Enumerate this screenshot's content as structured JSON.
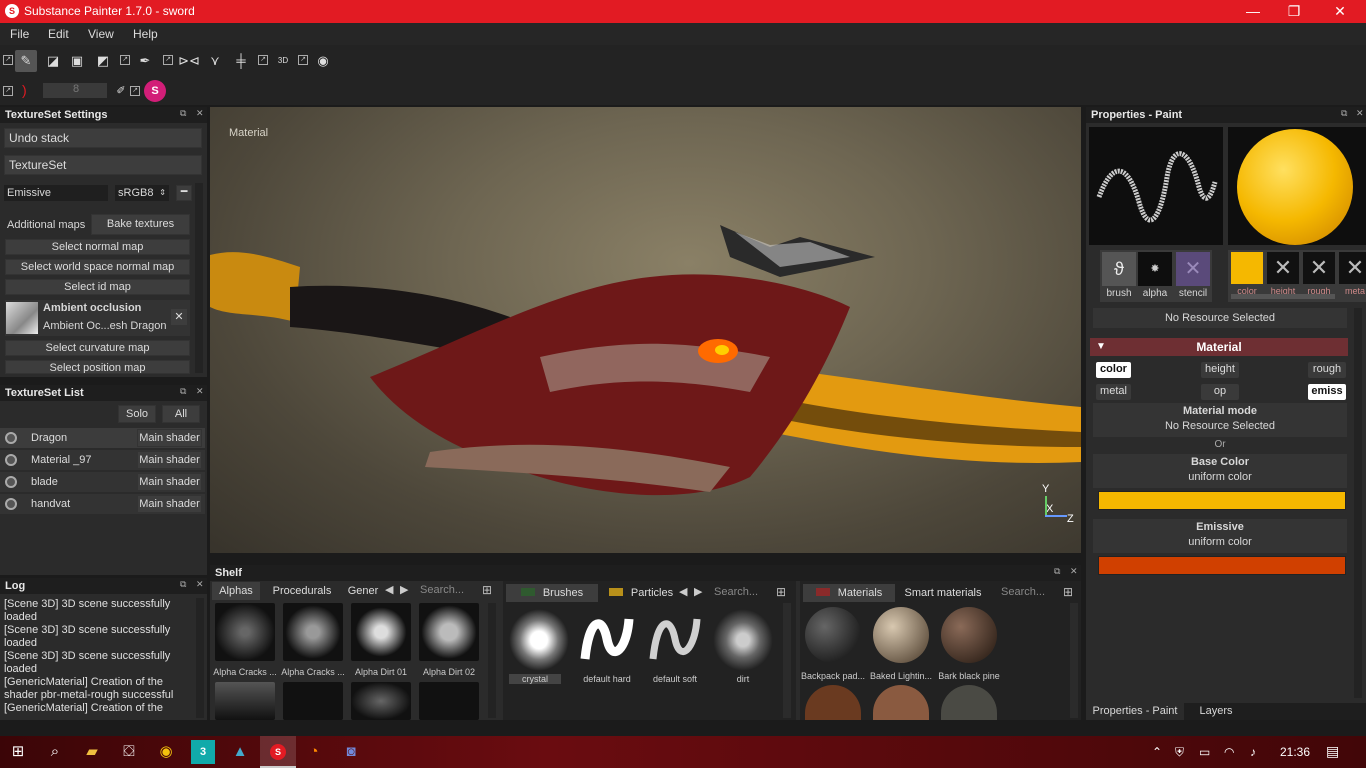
{
  "window": {
    "title": "Substance Painter 1.7.0 - sword",
    "minimize": "—",
    "restore": "❐",
    "close": "✕"
  },
  "menu": [
    "File",
    "Edit",
    "View",
    "Help"
  ],
  "toolbar": {
    "size_value": "8"
  },
  "textureset_settings": {
    "title": "TextureSet Settings",
    "undo_stack": "Undo stack",
    "textureset": "TextureSet",
    "channel": "Emissive",
    "format": "sRGB8",
    "additional_maps": "Additional maps",
    "bake_textures": "Bake textures",
    "select_normal": "Select normal map",
    "select_world_normal": "Select world space normal map",
    "select_id": "Select id map",
    "ao_title": "Ambient occlusion",
    "ao_sub": "Ambient Oc...esh Dragon",
    "select_curvature": "Select curvature map",
    "select_position": "Select position map"
  },
  "textureset_list": {
    "title": "TextureSet List",
    "solo": "Solo",
    "all": "All",
    "rows": [
      {
        "name": "Dragon",
        "shader": "Main shader"
      },
      {
        "name": "Material _97",
        "shader": "Main shader"
      },
      {
        "name": "blade",
        "shader": "Main shader"
      },
      {
        "name": "handvat",
        "shader": "Main shader"
      }
    ]
  },
  "log": {
    "title": "Log",
    "lines": [
      "[Scene 3D] 3D scene successfully loaded",
      "[Scene 3D] 3D scene successfully loaded",
      "[Scene 3D] 3D scene successfully loaded",
      "[GenericMaterial] Creation of the shader pbr-metal-rough successful",
      "[GenericMaterial] Creation of the"
    ]
  },
  "viewport": {
    "label": "Material",
    "axis_x": "X",
    "axis_y": "Y",
    "axis_z": "Z"
  },
  "shelf": {
    "title": "Shelf",
    "tabs1": [
      "Alphas",
      "Procedurals",
      "Gener"
    ],
    "search": "Search...",
    "alphas": [
      "Alpha Cracks ...",
      "Alpha Cracks ...",
      "Alpha Dirt 01",
      "Alpha Dirt 02"
    ],
    "tabs2": [
      "Brushes",
      "Particles"
    ],
    "brushes": [
      "crystal",
      "default hard",
      "default soft",
      "dirt"
    ],
    "tabs3": [
      "Materials",
      "Smart materials"
    ],
    "materials": [
      "Backpack pad...",
      "Baked Lightin...",
      "Bark black pine"
    ]
  },
  "properties": {
    "title": "Properties - Paint",
    "slots": [
      "brush",
      "alpha",
      "stencil"
    ],
    "channels_small": [
      "color",
      "height",
      "rough",
      "meta"
    ],
    "no_resource": "No Resource Selected",
    "material_header": "Material",
    "chips": [
      "color",
      "height",
      "rough",
      "metal",
      "op",
      "emiss"
    ],
    "material_mode": "Material mode",
    "mode_value": "No Resource Selected",
    "or": "Or",
    "base_color": "Base Color",
    "base_color_sub": "uniform color",
    "emissive": "Emissive",
    "emissive_sub": "uniform color",
    "colors": {
      "base": "#f5b800",
      "emissive": "#d04000",
      "accent": "#e21b23",
      "material_header": "#6e2f33"
    }
  },
  "bottom_tabs": [
    "Properties - Paint",
    "Layers"
  ],
  "taskbar": {
    "time": "21:36"
  }
}
